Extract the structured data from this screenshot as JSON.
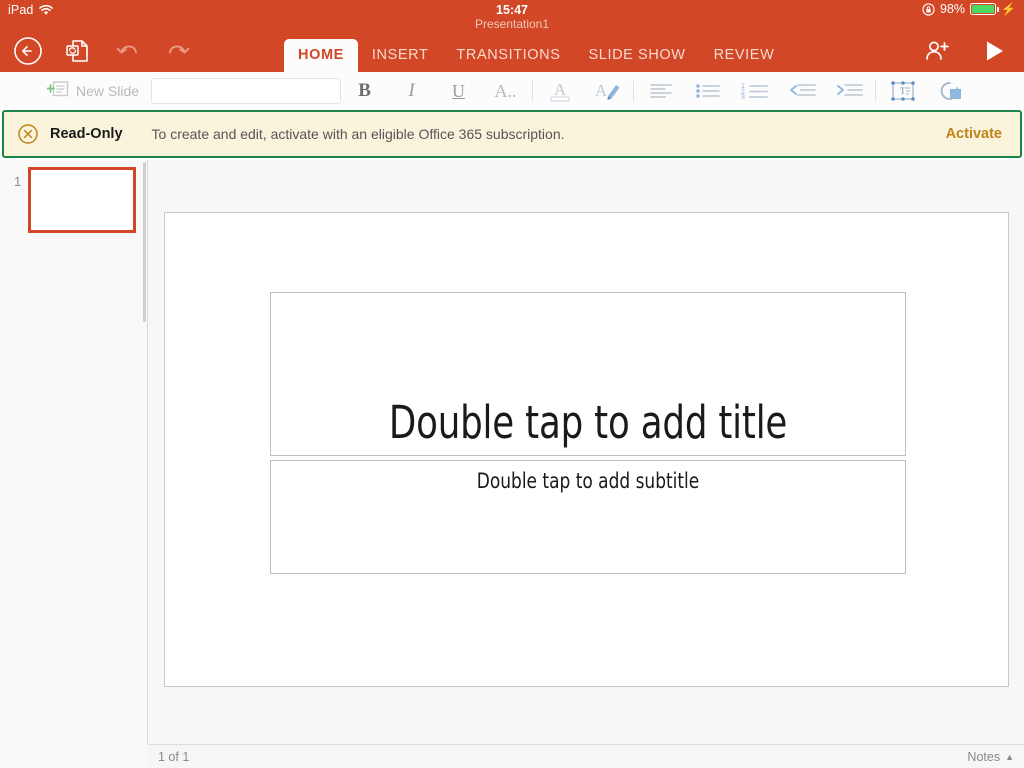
{
  "statusbar": {
    "device_label": "iPad",
    "wifi_icon": "wifi-icon",
    "rotation_lock_icon": "rotation-lock-icon",
    "battery_percent": "98%",
    "battery_icon": "battery-icon",
    "charging_icon": "lightning-bolt-icon"
  },
  "titleblock": {
    "time": "15:47",
    "document_name": "Presentation1"
  },
  "header": {
    "background_color": "#D24726",
    "back_icon": "back-arrow-circle-icon",
    "save_sync_icon": "file-sync-icon",
    "undo_icon": "undo-arrow-icon",
    "redo_icon": "redo-arrow-icon",
    "share_icon": "add-person-icon",
    "present_icon": "play-triangle-icon",
    "tabs": [
      {
        "label": "HOME",
        "active": true
      },
      {
        "label": "INSERT",
        "active": false
      },
      {
        "label": "TRANSITIONS",
        "active": false
      },
      {
        "label": "SLIDE SHOW",
        "active": false
      },
      {
        "label": "REVIEW",
        "active": false
      }
    ]
  },
  "ribbon": {
    "new_slide_label": "New Slide",
    "new_slide_icon": "new-slide-icon",
    "font_name_value": "",
    "font_name_placeholder": "",
    "font_size_value": "",
    "font_size_placeholder": "",
    "bold_label": "B",
    "italic_label": "I",
    "underline_label": "U",
    "more_format_label": "A..",
    "font_color_icon": "font-color-icon",
    "highlight_icon": "text-highlight-icon",
    "align_icon": "align-left-icon",
    "bullets_icon": "bulleted-list-icon",
    "numbering_icon": "numbered-list-icon",
    "decrease_indent_icon": "decrease-indent-icon",
    "increase_indent_icon": "increase-indent-icon",
    "textbox_icon": "text-box-icon",
    "shape_icon": "shape-arrange-icon"
  },
  "banner": {
    "close_icon": "circle-x-icon",
    "title": "Read-Only",
    "message": "To create and edit, activate with an eligible Office 365 subscription.",
    "action_label": "Activate",
    "border_color": "#1E8449",
    "background_color": "#FBF4DC",
    "action_color": "#C08419"
  },
  "sidebar": {
    "slides": [
      {
        "number": "1",
        "selected": true
      }
    ],
    "selection_color": "#D24726"
  },
  "slide": {
    "title_placeholder": "Double tap to add title",
    "subtitle_placeholder": "Double tap to add subtitle"
  },
  "bottombar": {
    "slide_counter": "1 of 1",
    "notes_label": "Notes",
    "notes_caret_icon": "caret-up-icon"
  }
}
